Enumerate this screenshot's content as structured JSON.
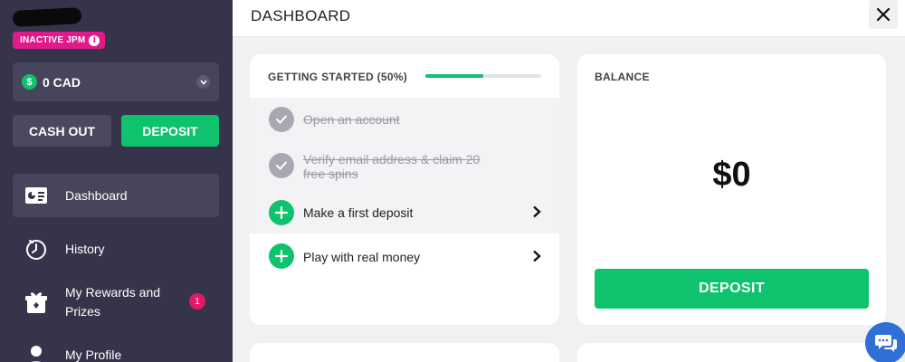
{
  "sidebar": {
    "status_badge": "INACTIVE JPM",
    "balance_display": "0 CAD",
    "currency_symbol": "$",
    "cash_out_label": "CASH OUT",
    "deposit_label": "DEPOSIT",
    "nav": [
      {
        "label": "Dashboard",
        "icon": "dashboard-icon",
        "active": true
      },
      {
        "label": "History",
        "icon": "history-icon"
      },
      {
        "label": "My Rewards and Prizes",
        "icon": "gift-icon",
        "badge": "1"
      },
      {
        "label": "My Profile",
        "icon": "profile-icon"
      }
    ]
  },
  "header": {
    "title": "DASHBOARD",
    "close_icon": "close-icon"
  },
  "getting_started": {
    "title": "GETTING STARTED (50%)",
    "progress": 0.5,
    "tasks": [
      {
        "label": "Open an account",
        "done": true
      },
      {
        "label": "Verify email address & claim 20 free spins",
        "done": true
      },
      {
        "label": "Make a first deposit",
        "done": false
      },
      {
        "label": "Play with real money",
        "done": false
      }
    ]
  },
  "balance_card": {
    "title": "BALANCE",
    "value": "$0",
    "deposit_label": "DEPOSIT"
  },
  "colors": {
    "accent_green": "#0ec26e",
    "sidebar_bg": "#35344a",
    "badge_pink": "#e01a8b",
    "chat_blue": "#2f6fd6"
  }
}
